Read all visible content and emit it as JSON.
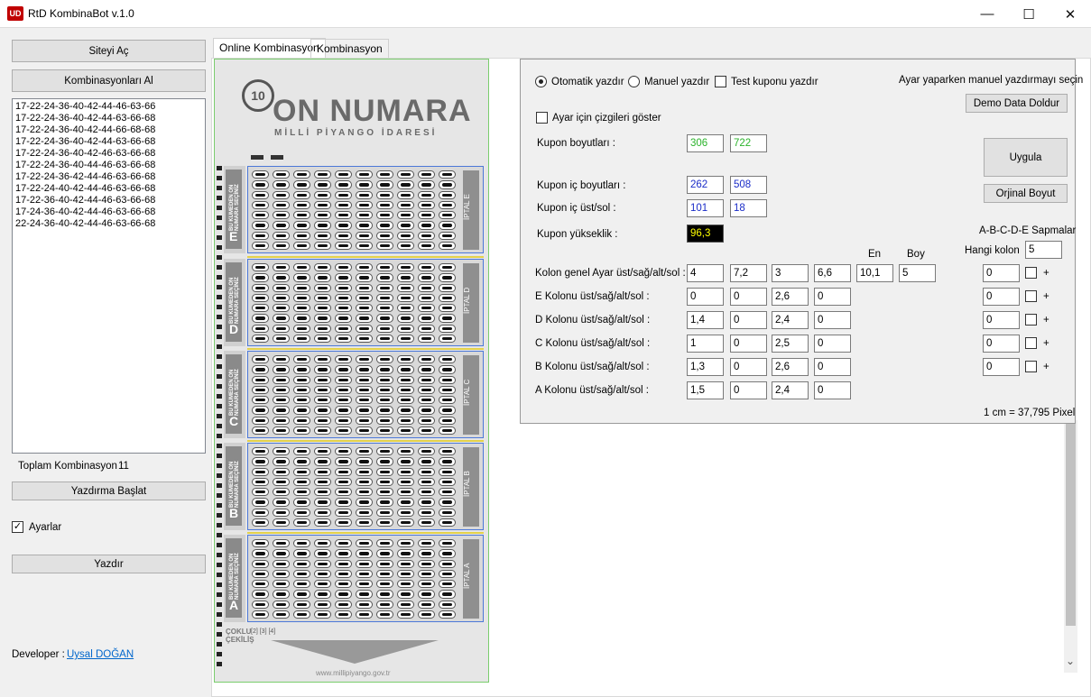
{
  "window": {
    "title": "RtD KombinaBot v.1.0",
    "icon_text": "UD",
    "minimize": "—",
    "maximize": "☐",
    "close": "✕"
  },
  "left": {
    "open_site": "Siteyi Aç",
    "get_combinations": "Kombinasyonları Al",
    "combinations": [
      "17-22-24-36-40-42-44-46-63-66",
      "17-22-24-36-40-42-44-63-66-68",
      "17-22-24-36-40-42-44-66-68-68",
      "17-22-24-36-40-42-44-63-66-68",
      "17-22-24-36-40-42-46-63-66-68",
      "17-22-24-36-40-44-46-63-66-68",
      "17-22-24-36-42-44-46-63-66-68",
      "17-22-24-40-42-44-46-63-66-68",
      "17-22-36-40-42-44-46-63-66-68",
      "17-24-36-40-42-44-46-63-66-68",
      "22-24-36-40-42-44-46-63-66-68"
    ],
    "total_label": "Toplam Kombinasyon :",
    "total_value": "11",
    "start_print": "Yazdırma Başlat",
    "settings_label": "Ayarlar",
    "print": "Yazdır",
    "developer_label": "Developer :",
    "developer_name": "Uysal DOĞAN"
  },
  "tabs": [
    "Online Kombinasyon",
    "Kombinasyon"
  ],
  "coupon": {
    "logo": "ON NUMARA",
    "subtitle": "MİLLİ PİYANGO İDARESİ",
    "column_letters": [
      "E",
      "D",
      "C",
      "B",
      "A"
    ],
    "side_text": "BU KÜMEDEN ON NUMARA SEÇİNİZ",
    "iptal": [
      "İPTAL E",
      "İPTAL D",
      "İPTAL C",
      "İPTAL B",
      "İPTAL A"
    ],
    "footer_side": "ÇOKLU ÇEKİLİŞ",
    "footer_nums": "[2]  [3]  [4]",
    "website": "www.millipiyango.gov.tr"
  },
  "settings": {
    "auto_print": "Otomatik yazdır",
    "manual_print": "Manuel yazdır",
    "test_print": "Test kuponu yazdır",
    "hint": "Ayar yaparken manuel yazdırmayı seçin",
    "demo_button": "Demo Data Doldur",
    "show_lines": "Ayar için çizgileri göster",
    "coupon_size_label": "Kupon boyutları :",
    "coupon_size": [
      "306",
      "722"
    ],
    "apply": "Uygula",
    "inner_size_label": "Kupon iç boyutları :",
    "inner_size": [
      "262",
      "508"
    ],
    "original_size": "Orjinal Boyut",
    "inner_topleft_label": "Kupon iç üst/sol :",
    "inner_topleft": [
      "101",
      "18"
    ],
    "deviations_title": "A-B-C-D-E Sapmalar",
    "height_label": "Kupon yükseklik :",
    "height": "96,3",
    "which_col_label": "Hangi kolon",
    "which_col": "5",
    "en_label": "En",
    "boy_label": "Boy",
    "rows": [
      {
        "label": "Kolon genel Ayar üst/sağ/alt/sol :",
        "values": [
          "4",
          "7,2",
          "3",
          "6,6"
        ],
        "en": "10,1",
        "boy": "5",
        "dev": "0"
      },
      {
        "label": "E Kolonu üst/sağ/alt/sol :",
        "values": [
          "0",
          "0",
          "2,6",
          "0"
        ],
        "dev": "0"
      },
      {
        "label": "D Kolonu üst/sağ/alt/sol :",
        "values": [
          "1,4",
          "0",
          "2,4",
          "0"
        ],
        "dev": "0"
      },
      {
        "label": "C Kolonu üst/sağ/alt/sol :",
        "values": [
          "1",
          "0",
          "2,5",
          "0"
        ],
        "dev": "0"
      },
      {
        "label": "B Kolonu üst/sağ/alt/sol :",
        "values": [
          "1,3",
          "0",
          "2,6",
          "0"
        ],
        "dev": "0"
      },
      {
        "label": "A Kolonu üst/sağ/alt/sol :",
        "values": [
          "1,5",
          "0",
          "2,4",
          "0"
        ]
      }
    ],
    "plus": "+",
    "cm_pixel": "1 cm = 37,795 Pixel"
  }
}
